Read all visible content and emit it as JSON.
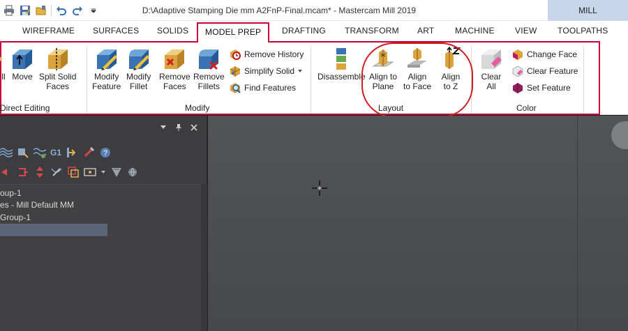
{
  "app": {
    "title": "D:\\Adaptive Stamping Die mm A2FnP-Final.mcam* - Mastercam Mill 2019",
    "context_tab": "MILL"
  },
  "quick_access": [
    "print-icon",
    "save-as-icon",
    "open-icon",
    "undo-icon",
    "redo-icon",
    "customize-dropdown-icon"
  ],
  "ribbon_tabs": [
    "WIREFRAME",
    "SURFACES",
    "SOLIDS",
    "MODEL PREP",
    "DRAFTING",
    "TRANSFORM",
    "ART",
    "MACHINE",
    "VIEW",
    "TOOLPATHS"
  ],
  "active_tab": "MODEL PREP",
  "groups": {
    "direct_editing": {
      "label": "Direct Editing",
      "buttons": {
        "pull": "ll",
        "move": "Move",
        "split_1": "Split Solid",
        "split_2": "Faces"
      }
    },
    "modify": {
      "label": "Modify",
      "buttons": {
        "modify_feature_1": "Modify",
        "modify_feature_2": "Feature",
        "modify_fillet_1": "Modify",
        "modify_fillet_2": "Fillet",
        "remove_faces_1": "Remove",
        "remove_faces_2": "Faces",
        "remove_fillets_1": "Remove",
        "remove_fillets_2": "Fillets",
        "remove_history": "Remove History",
        "simplify_solid": "Simplify Solid",
        "find_features": "Find Features"
      }
    },
    "layout": {
      "label": "Layout",
      "buttons": {
        "disassemble": "Disassemble",
        "align_plane_1": "Align to",
        "align_plane_2": "Plane",
        "align_face_1": "Align",
        "align_face_2": "to Face",
        "align_z_1": "Align",
        "align_z_2": "to Z"
      }
    },
    "color": {
      "label": "Color",
      "buttons": {
        "clear_all_1": "Clear",
        "clear_all_2": "All",
        "change_face": "Change Face",
        "clear_feature": "Clear Feature",
        "set_feature": "Set Feature"
      }
    }
  },
  "panel": {
    "header_icons": [
      "dropdown-icon",
      "pin-icon",
      "close-icon"
    ],
    "toolbar_row1_label": "G1",
    "tree_rows": [
      "oup-1",
      "es - Mill Default MM",
      " Group-1",
      ""
    ]
  },
  "colors": {
    "accent_red": "#c8003a",
    "annotation_red": "#cc1e1e",
    "viewport": "#4b4d50",
    "panel": "#3d3d3f"
  }
}
